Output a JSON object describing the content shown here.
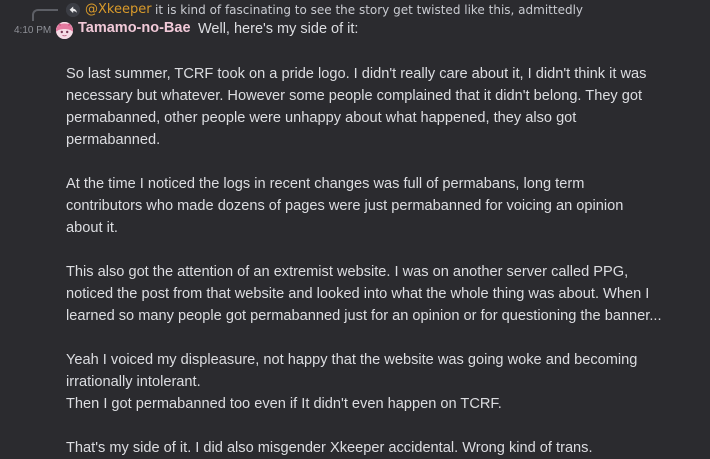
{
  "reply": {
    "author": "@Xkeeper",
    "text": "it is kind of fascinating to see the story get twisted like this, admittedly"
  },
  "message": {
    "timestamp": "4:10 PM",
    "author": "Tamamo-no-Bae",
    "first_line": "Well, here's my side of it:",
    "paragraphs": [
      {
        "lines": [
          "So last summer, TCRF took on a pride logo. I didn't really care about it, I didn't think it was",
          "necessary but whatever. However some people complained that it didn't belong. They got",
          "permabanned, other people were unhappy about what happened, they also got",
          "permabanned."
        ]
      },
      {
        "lines": [
          "At the time I noticed the logs in recent changes was full of permabans, long term",
          "contributors who made dozens of pages were just permabanned for voicing an opinion",
          "about it."
        ]
      },
      {
        "lines": [
          "This also got the attention of an extremist website. I was on another server called PPG,",
          "noticed the post from that website and looked into what the whole thing was about. When I",
          "learned so many people got permabanned just for an opinion or for questioning the banner..."
        ]
      },
      {
        "lines": [
          "Yeah I voiced my displeasure, not happy that the website was going woke and becoming",
          "irrationally intolerant.",
          "Then I got permabanned too even if It didn't even happen on TCRF."
        ]
      },
      {
        "lines": [
          "That's my side of it. I did also misgender Xkeeper accidental. Wrong kind of trans."
        ]
      }
    ]
  },
  "colors": {
    "background": "#2b2b2f",
    "reply_author": "#d89a2b",
    "username": "#f1c9d8",
    "text": "#dcdde1",
    "timestamp": "#8e9097"
  },
  "icons": {
    "reply_avatar": "reply-arrow-icon",
    "avatar": "anime-avatar-icon"
  }
}
